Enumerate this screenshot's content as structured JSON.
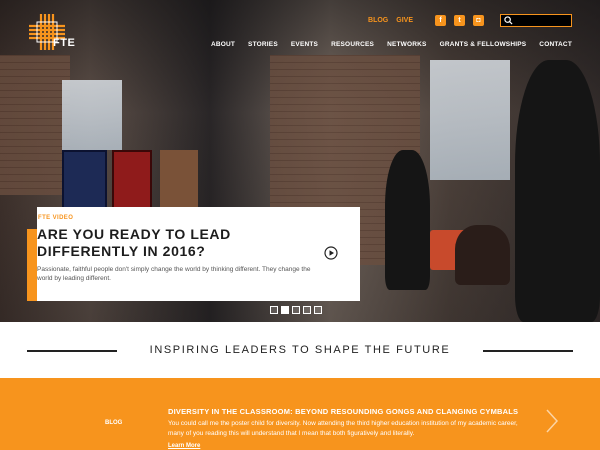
{
  "brand": {
    "logo_text": "FTE",
    "accent": "#f7941d"
  },
  "utility_nav": {
    "blog": "BLOG",
    "give": "GIVE"
  },
  "social": [
    {
      "name": "facebook-icon",
      "glyph": "f"
    },
    {
      "name": "twitter-icon",
      "glyph": "t"
    },
    {
      "name": "instagram-icon",
      "glyph": "◘"
    }
  ],
  "search": {
    "placeholder": ""
  },
  "main_nav": [
    "ABOUT",
    "STORIES",
    "EVENTS",
    "RESOURCES",
    "NETWORKS",
    "GRANTS & FELLOWSHIPS",
    "CONTACT"
  ],
  "hero": {
    "eyebrow": "FTE VIDEO",
    "title": "ARE YOU READY TO LEAD DIFFERENTLY IN 2016?",
    "description": "Passionate, faithful people don't simply change the world by thinking different. They change the world by leading different.",
    "slides": 5,
    "active_slide": 1
  },
  "tagline": "INSPIRING LEADERS TO SHAPE THE FUTURE",
  "featured_post": {
    "label": "BLOG",
    "title": "DIVERSITY IN THE CLASSROOM: BEYOND RESOUNDING GONGS AND CLANGING CYMBALS",
    "excerpt": "You could call me the poster child for diversity. Now attending the third higher education institution of my academic career, many of you reading this will understand that I mean that both figuratively and literally.",
    "link": "Learn More"
  }
}
